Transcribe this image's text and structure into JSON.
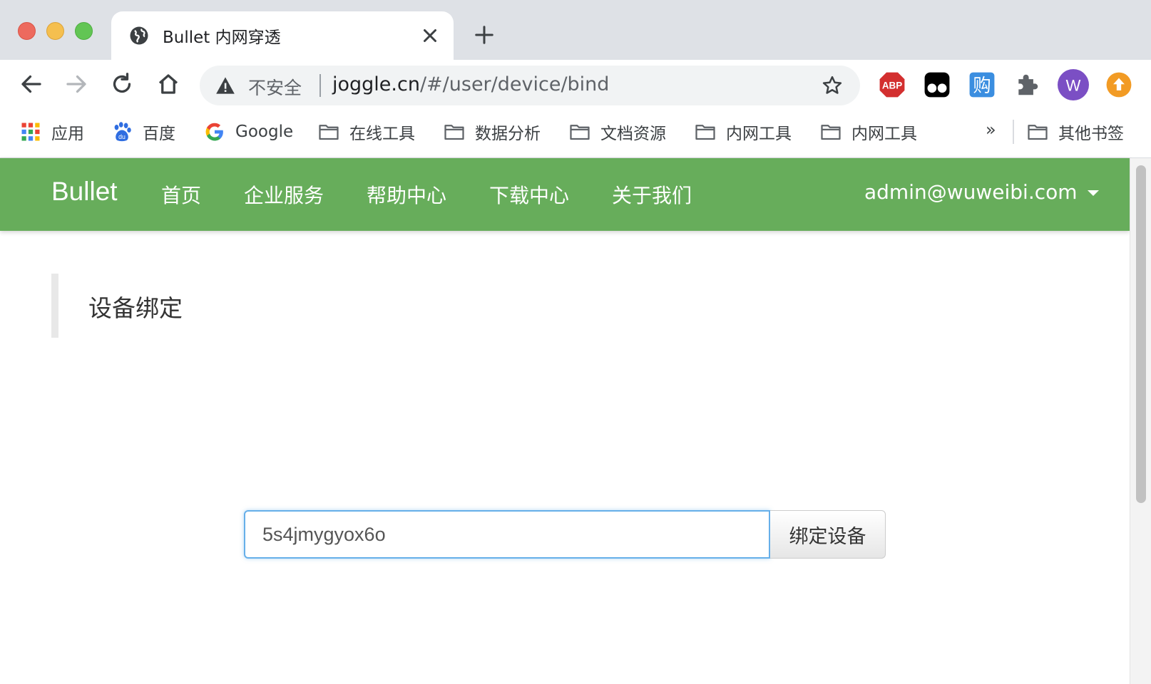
{
  "browser": {
    "tab": {
      "title": "Bullet 内网穿透",
      "favicon": "globe-icon"
    },
    "address_bar": {
      "security_label": "不安全",
      "url_host": "joggle.cn",
      "url_path": "/#/user/device/bind"
    },
    "extensions": [
      {
        "name": "adblock-plus-icon",
        "label": "ABP",
        "color": "#d32f2f"
      },
      {
        "name": "tampermonkey-icon",
        "color": "#000000"
      },
      {
        "name": "shopping-helper-icon",
        "label": "购",
        "color": "#3b8ee0"
      },
      {
        "name": "puzzle-icon",
        "color": "#5f6368"
      },
      {
        "name": "profile-avatar",
        "label": "W",
        "color": "#7b4fc4"
      },
      {
        "name": "update-icon",
        "color": "#f29b24"
      }
    ],
    "bookmarks": [
      {
        "label": "应用",
        "icon": "apps-grid-icon"
      },
      {
        "label": "百度",
        "icon": "baidu-icon"
      },
      {
        "label": "Google",
        "icon": "google-icon"
      },
      {
        "label": "在线工具",
        "icon": "folder-icon"
      },
      {
        "label": "数据分析",
        "icon": "folder-icon"
      },
      {
        "label": "文档资源",
        "icon": "folder-icon"
      },
      {
        "label": "内网工具",
        "icon": "folder-icon"
      },
      {
        "label": "内网工具",
        "icon": "folder-icon"
      }
    ],
    "bookmarks_more": "»",
    "other_bookmarks": "其他书签"
  },
  "site": {
    "brand": "Bullet",
    "nav": [
      "首页",
      "企业服务",
      "帮助中心",
      "下载中心",
      "关于我们"
    ],
    "user": "admin@wuweibi.com",
    "primary_color": "#67ad5b"
  },
  "main": {
    "heading": "设备绑定",
    "device_input_value": "5s4jmygyox6o",
    "bind_button_label": "绑定设备"
  }
}
